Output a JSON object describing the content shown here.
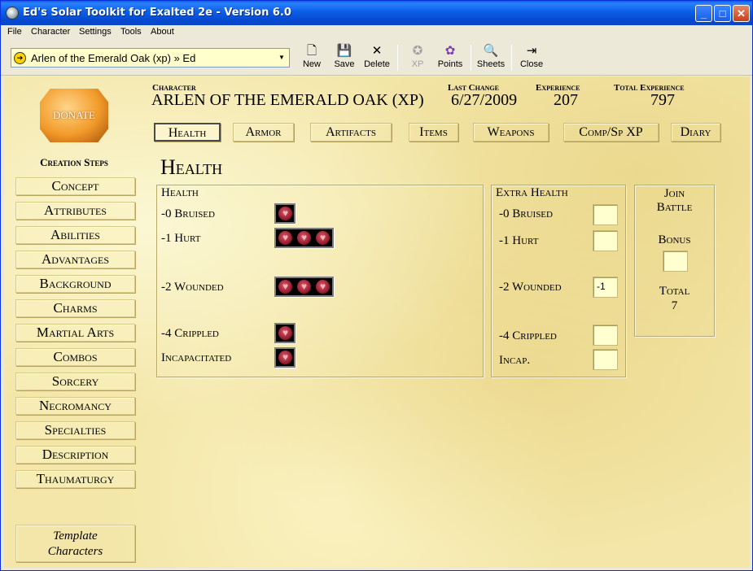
{
  "window": {
    "title": "Ed's Solar Toolkit for Exalted 2e - Version 6.0"
  },
  "menu": [
    "File",
    "Character",
    "Settings",
    "Tools",
    "About"
  ],
  "toolbar": {
    "character_select": "Arlen of the Emerald Oak (xp) » Ed",
    "buttons": [
      {
        "label": "New",
        "icon": "new-document-icon"
      },
      {
        "label": "Save",
        "icon": "floppy-disk-icon"
      },
      {
        "label": "Delete",
        "icon": "delete-x-icon"
      },
      {
        "label": "XP",
        "icon": "xp-icon",
        "disabled": true
      },
      {
        "label": "Points",
        "icon": "points-icon"
      },
      {
        "label": "Sheets",
        "icon": "sheets-icon"
      },
      {
        "label": "Close",
        "icon": "exit-door-icon"
      }
    ]
  },
  "donate": {
    "label": "DONATE"
  },
  "creation_steps": {
    "title": "Creation Steps",
    "items": [
      "Concept",
      "Attributes",
      "Abilities",
      "Advantages",
      "Background",
      "Charms",
      "Martial Arts",
      "Combos",
      "Sorcery",
      "Necromancy",
      "Specialties",
      "Description",
      "Thaumaturgy"
    ],
    "template_line1": "Template",
    "template_line2": "Characters"
  },
  "header": {
    "character_label": "Character",
    "character_name": "ARLEN OF THE EMERALD OAK (XP)",
    "last_change_label": "Last Change",
    "last_change": "6/27/2009",
    "experience_label": "Experience",
    "experience": "207",
    "total_experience_label": "Total Experience",
    "total_experience": "797"
  },
  "tabs": [
    "Health",
    "Armor",
    "Artifacts",
    "Items",
    "Weapons",
    "Comp/Sp XP",
    "Diary"
  ],
  "active_tab": "Health",
  "section_title": "Health",
  "health": {
    "label": "Health",
    "levels": [
      {
        "label": "-0 Bruised",
        "hearts": 1
      },
      {
        "label": "-1 Hurt",
        "hearts": 3
      },
      {
        "label": "-2 Wounded",
        "hearts": 3
      },
      {
        "label": "-4 Crippled",
        "hearts": 1
      },
      {
        "label": "Incapacitated",
        "hearts": 1
      }
    ]
  },
  "extra_health": {
    "label": "Extra Health",
    "levels": [
      {
        "label": "-0 Bruised",
        "value": ""
      },
      {
        "label": "-1 Hurt",
        "value": ""
      },
      {
        "label": "-2 Wounded",
        "value": "-1"
      },
      {
        "label": "-4 Crippled",
        "value": ""
      },
      {
        "label": "Incap.",
        "value": ""
      }
    ]
  },
  "join_battle": {
    "line1": "Join",
    "line2": "Battle",
    "bonus_label": "Bonus",
    "bonus_value": "",
    "total_label": "Total",
    "total_value": "7"
  },
  "colors": {
    "titlebar": "#0a5de0",
    "parchment": "#f3e6a8",
    "heart": "#8e1626",
    "input_bg": "#ffffd0"
  }
}
